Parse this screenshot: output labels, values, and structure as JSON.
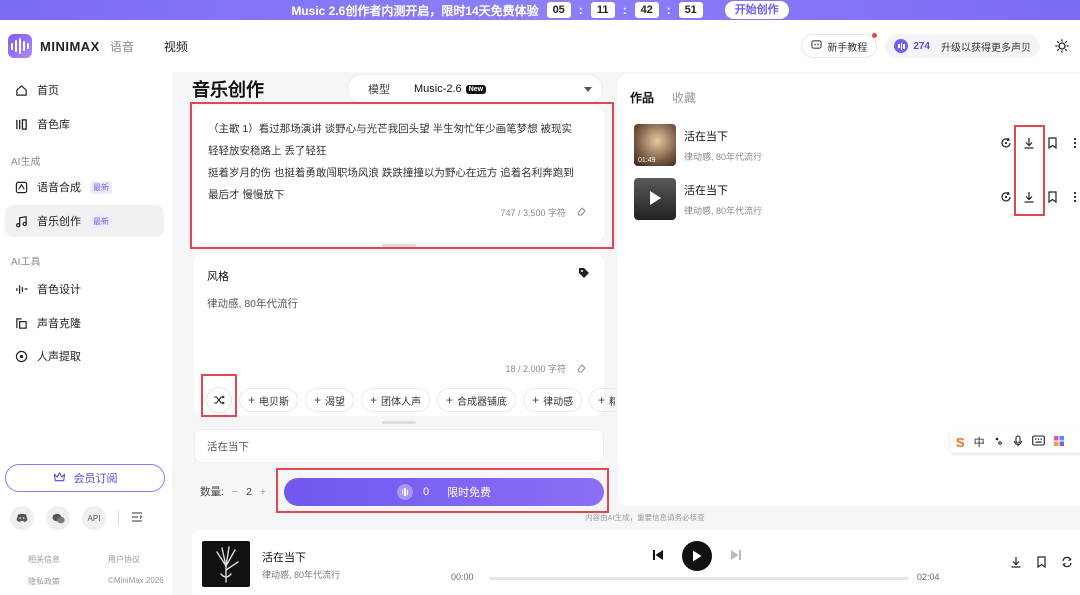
{
  "promo": {
    "text": "Music 2.6创作者内测开启，限时14天免费体验",
    "countdown": [
      "05",
      "11",
      "42",
      "51"
    ],
    "cta": "开始创作"
  },
  "header": {
    "brand": "MINIMAX",
    "brand_sub": "语音",
    "nav_video": "视频",
    "tutorial": "新手教程",
    "credits": "274",
    "upgrade": "升级以获得更多声贝"
  },
  "sidebar": {
    "items": [
      {
        "label": "首页",
        "icon": "home-icon"
      },
      {
        "label": "音色库",
        "icon": "library-icon"
      }
    ],
    "section_ai_gen": "AI生成",
    "ai_gen_items": [
      {
        "label": "语音合成",
        "badge": "最新",
        "icon": "speech-synthesis-icon"
      },
      {
        "label": "音乐创作",
        "badge": "最新",
        "icon": "music-note-icon",
        "active": true
      }
    ],
    "section_ai_tools": "AI工具",
    "ai_tool_items": [
      {
        "label": "音色设计",
        "icon": "voice-design-icon"
      },
      {
        "label": "声音克隆",
        "icon": "voice-clone-icon"
      },
      {
        "label": "人声提取",
        "icon": "vocal-extract-icon"
      }
    ],
    "member_btn": "会员订阅",
    "social_api": "API",
    "footer": {
      "links_row1": [
        "相关信息",
        "用户协议"
      ],
      "links_row2": [
        "隐私政策",
        "©MiniMax 2026"
      ]
    }
  },
  "main": {
    "title": "音乐创作",
    "model_label": "模型",
    "model_value": "Music-2.6",
    "model_badge": "New",
    "lyrics_lines": [
      "（主歌 1）看过那场演讲 谈野心与光芒我回头望 半生匆忙年少画笔梦想 被现实",
      "轻轻放安稳路上 丢了轻狂",
      "挺着岁月的伤 也挺着勇敢闯职场风浪 跌跌撞撞以为野心在远方 追着名利奔跑到",
      "最后才 慢慢放下"
    ],
    "lyrics_counter": "747 / 3,500 字符",
    "style_heading": "风格",
    "style_text": "律动感, 80年代流行",
    "style_counter": "18 / 2,000 字符",
    "chips": [
      "电贝斯",
      "渴望",
      "团体人声",
      "合成器铺底",
      "律动感",
      "精"
    ],
    "title_value": "活在当下",
    "qty_label": "数量:",
    "qty_minus": "−",
    "qty_value": "2",
    "qty_plus": "+",
    "generate_cost": "0",
    "generate_label": "限时免费"
  },
  "right": {
    "tabs": [
      "作品",
      "收藏"
    ],
    "works": [
      {
        "title": "活在当下",
        "desc": "律动感, 80年代流行",
        "duration": "01:49"
      },
      {
        "title": "活在当下",
        "desc": "律动感, 80年代流行",
        "duration": ""
      }
    ],
    "ai_note": "内容由AI生成，重要信息请务必核查"
  },
  "ime": {
    "logo": "S",
    "mode": "中"
  },
  "player": {
    "title": "活在当下",
    "desc": "律动感, 80年代流行",
    "time_current": "00:00",
    "time_total": "02:04",
    "progress": 0
  },
  "colors": {
    "accent": "#7357f0",
    "highlight_box": "#e0474f",
    "promo_bg": "#7b6cf5"
  }
}
